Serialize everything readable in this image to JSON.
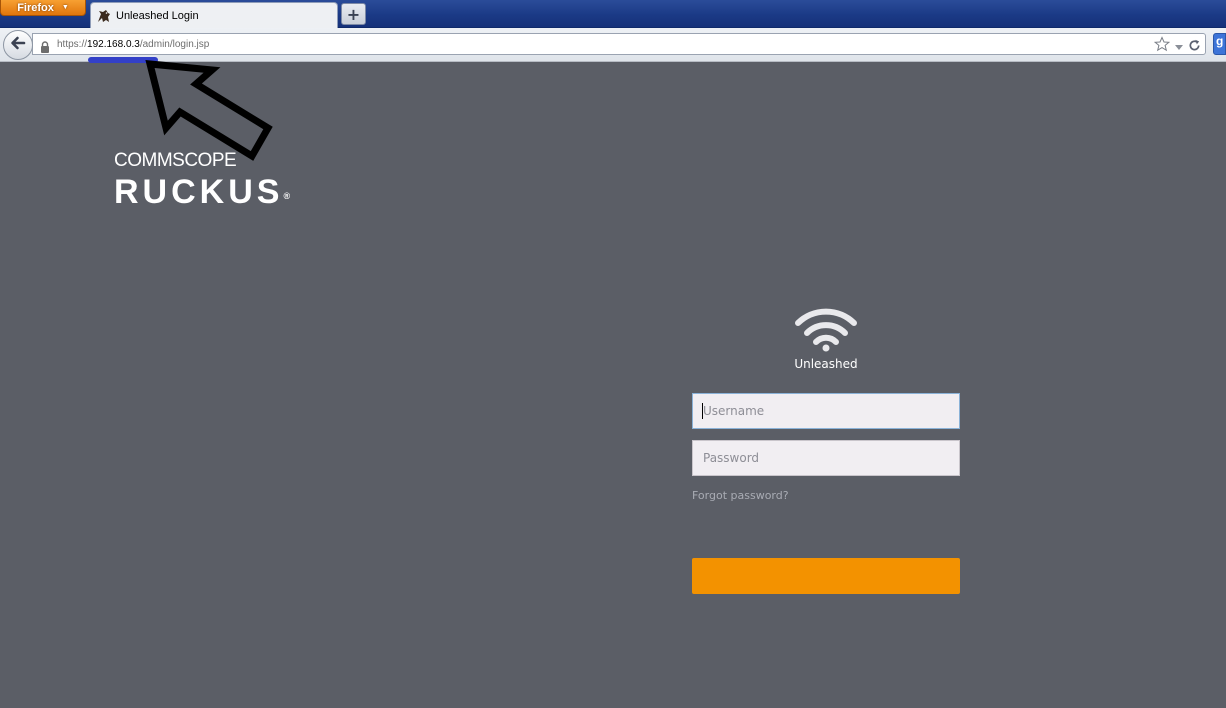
{
  "browser": {
    "app_button_label": "Firefox",
    "tab": {
      "title": "Unleashed Login"
    },
    "new_tab_label": "+",
    "url": {
      "scheme": "https://",
      "host": "192.168.0.3",
      "path": "/admin/login.jsp"
    }
  },
  "page": {
    "logo": {
      "commscope": "COMMSCOPE",
      "ruckus": "RUCKUS",
      "registered": "®"
    },
    "product_name": "Unleashed",
    "username": {
      "value": "",
      "placeholder": "Username"
    },
    "password": {
      "value": "",
      "placeholder": "Password"
    },
    "forgot_password_label": "Forgot password?",
    "login_button_label": ""
  },
  "colors": {
    "page_background": "#5b5e66",
    "accent": "#f39200",
    "firefox_button": "#e8831a",
    "annotation_underline": "#3340c8"
  }
}
